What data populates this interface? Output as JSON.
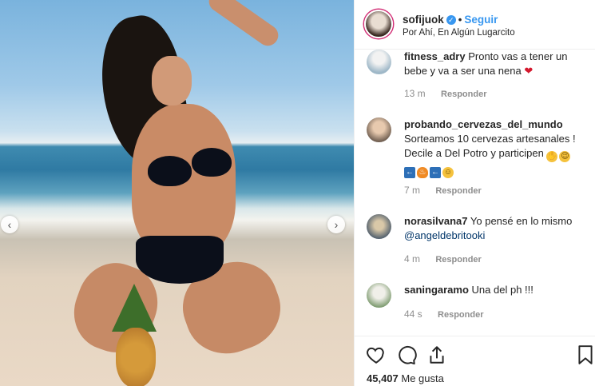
{
  "post": {
    "username": "sofijuok",
    "follow_label": "Seguir",
    "location": "Por Ahí, En Algún Lugarcito",
    "nav_prev": "‹",
    "nav_next": "›"
  },
  "comments": [
    {
      "user": "fitness_adry",
      "text": "Pronto vas a tener un bebe y va a ser una nena",
      "time": "13 m",
      "reply": "Responder"
    },
    {
      "user": "probando_cervezas_del_mundo",
      "text": "Sorteamos 10 cervezas artesanales ! Decile a Del Potro y participen",
      "time": "7 m",
      "reply": "Responder"
    },
    {
      "user": "norasilvana7",
      "text": "Yo pensé en lo mismo",
      "mention": "@angeldebritooki",
      "time": "4 m",
      "reply": "Responder"
    },
    {
      "user": "saningaramo",
      "text": "Una del ph !!!",
      "time": "44 s",
      "reply": "Responder"
    }
  ],
  "likes": {
    "count": "45,407",
    "label": "Me gusta"
  },
  "icons": {
    "like": "heart-outline-icon",
    "comment": "comment-bubble-icon",
    "share": "share-upload-icon",
    "save": "bookmark-icon"
  },
  "colors": {
    "link": "#3897f0",
    "text": "#262626",
    "muted": "#8e8e8e",
    "mention": "#003569"
  }
}
